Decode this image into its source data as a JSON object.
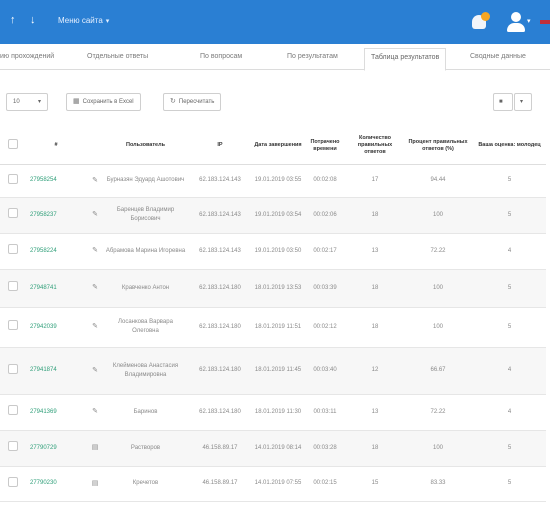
{
  "topbar": {
    "icon_left_1": "↑",
    "icon_left_2": "↓",
    "menu_label": "Меню сайта",
    "menu_caret": "▾",
    "user_caret": "▾"
  },
  "tabs": [
    {
      "label": "ию прохождений"
    },
    {
      "label": "Отдельные ответы"
    },
    {
      "label": "По вопросам"
    },
    {
      "label": "По результатам"
    },
    {
      "label": "Таблица результатов",
      "active": true
    },
    {
      "label": "Сводные данные"
    }
  ],
  "toolbar": {
    "page_size": "10",
    "page_size_caret": "▾",
    "export_label": "Сохранить в Excel",
    "recalc_label": "Пересчитать",
    "trash_caret": "▾"
  },
  "table": {
    "headers": [
      "#",
      "Пользователь",
      "IP",
      "Дата завершения",
      "Потрачено времени",
      "Количество правильных ответов",
      "Процент правильных ответов (%)",
      "Ваша оценка: молодец"
    ],
    "rows": [
      {
        "id": "27958254",
        "icon": "edit",
        "user": "Бурназян Эдуард Ашотович",
        "ip": "62.183.124.143",
        "date": "19.01.2019 03:55",
        "time": "00:02:08",
        "correct": "17",
        "percent": "94.44",
        "grade": "5"
      },
      {
        "id": "27958237",
        "icon": "edit",
        "user": "Баренцев Владимир Борисович",
        "ip": "62.183.124.143",
        "date": "19.01.2019 03:54",
        "time": "00:02:06",
        "correct": "18",
        "percent": "100",
        "grade": "5"
      },
      {
        "id": "27958224",
        "icon": "edit",
        "user": "Абрамова Марина Игоревна",
        "ip": "62.183.124.143",
        "date": "19.01.2019 03:50",
        "time": "00:02:17",
        "correct": "13",
        "percent": "72.22",
        "grade": "4"
      },
      {
        "id": "27948741",
        "icon": "edit",
        "user": "Кравченко Антон",
        "ip": "62.183.124.180",
        "date": "18.01.2019 13:53",
        "time": "00:03:39",
        "correct": "18",
        "percent": "100",
        "grade": "5"
      },
      {
        "id": "27942039",
        "icon": "edit",
        "user": "Лосанкова Варвара Олеговна",
        "ip": "62.183.124.180",
        "date": "18.01.2019 11:51",
        "time": "00:02:12",
        "correct": "18",
        "percent": "100",
        "grade": "5"
      },
      {
        "id": "27941874",
        "icon": "edit",
        "user": "Клейменова Анастасия Владимировна",
        "ip": "62.183.124.180",
        "date": "18.01.2019 11:45",
        "time": "00:03:40",
        "correct": "12",
        "percent": "66.67",
        "grade": "4"
      },
      {
        "id": "27941369",
        "icon": "edit",
        "user": "Баринов",
        "ip": "62.183.124.180",
        "date": "18.01.2019 11:30",
        "time": "00:03:11",
        "correct": "13",
        "percent": "72.22",
        "grade": "4"
      },
      {
        "id": "27790729",
        "icon": "doc",
        "user": "Растворов",
        "ip": "46.158.89.17",
        "date": "14.01.2019 08:14",
        "time": "00:03:28",
        "correct": "18",
        "percent": "100",
        "grade": "5"
      },
      {
        "id": "27790230",
        "icon": "doc",
        "user": "Кречетов",
        "ip": "46.158.89.17",
        "date": "14.01.2019 07:55",
        "time": "00:02:15",
        "correct": "15",
        "percent": "83.33",
        "grade": "5"
      }
    ]
  },
  "colors": {
    "topbar": "#2a7fd3",
    "link": "#2f9f79",
    "notification": "#f5a623"
  },
  "icons": {
    "edit": "✎",
    "doc": "▤",
    "export": "excel-icon",
    "recalc": "refresh-icon",
    "trash": "trash-icon"
  }
}
